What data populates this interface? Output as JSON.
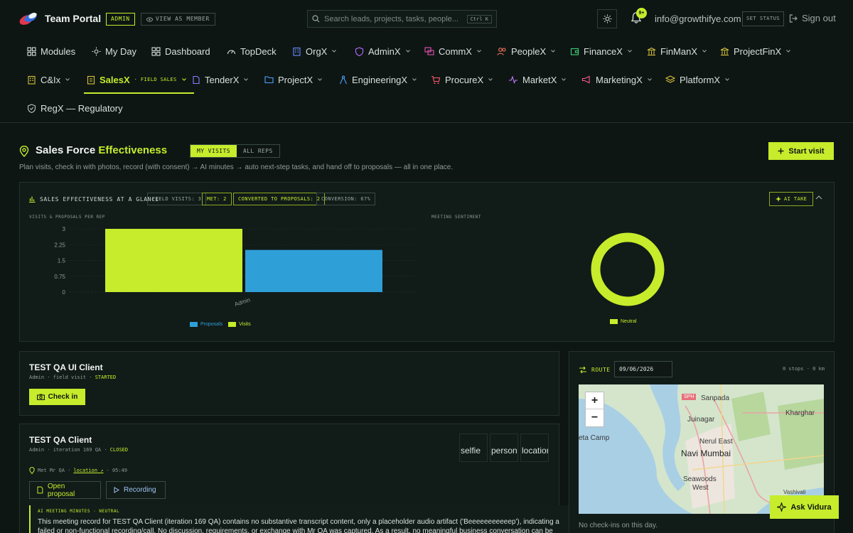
{
  "app": {
    "brand": "Team Portal",
    "role_badge": "ADMIN",
    "view_as": "VIEW AS MEMBER",
    "search_placeholder": "Search leads, projects, tasks, people...",
    "search_shortcut": "Ctrl K",
    "notification_count": "9+",
    "email": "info@growthifye.com",
    "set_status": "SET STATUS",
    "sign_out": "Sign out"
  },
  "nav": {
    "row1": [
      {
        "label": "Modules",
        "icon": "grid-icon"
      },
      {
        "label": "My Day",
        "icon": "sun-icon"
      },
      {
        "label": "Dashboard",
        "icon": "grid-icon"
      },
      {
        "label": "TopDeck",
        "icon": "gauge-icon"
      },
      {
        "label": "OrgX",
        "icon": "building-icon"
      },
      {
        "label": "AdminX",
        "icon": "shield-icon"
      },
      {
        "label": "CommX",
        "icon": "chat-icon"
      },
      {
        "label": "PeopleX",
        "icon": "people-icon"
      },
      {
        "label": "FinanceX",
        "icon": "wallet-icon"
      },
      {
        "label": "FinManX",
        "icon": "bank-icon"
      },
      {
        "label": "ProjectFinX",
        "icon": "bank-icon"
      }
    ],
    "row2": [
      {
        "label": "C&Ix",
        "icon": "building-icon"
      },
      {
        "label": "SalesX",
        "sub": "· FIELD SALES",
        "icon": "clipboard-icon"
      },
      {
        "label": "TenderX",
        "icon": "doc-icon"
      },
      {
        "label": "ProjectX",
        "icon": "folder-icon"
      },
      {
        "label": "EngineeringX",
        "icon": "compass-icon"
      },
      {
        "label": "ProcureX",
        "icon": "cart-icon"
      },
      {
        "label": "MarketX",
        "icon": "pulse-icon"
      },
      {
        "label": "MarketingX",
        "icon": "megaphone-icon"
      },
      {
        "label": "PlatformX",
        "icon": "layers-icon"
      }
    ],
    "row3": [
      {
        "label": "RegX — Regulatory",
        "icon": "shield-icon"
      }
    ]
  },
  "page": {
    "title_a": "Sales Force",
    "title_b": "Effectiveness",
    "tabs": [
      "MY VISITS",
      "ALL REPS"
    ],
    "active_tab": "MY VISITS",
    "start_visit": "Start visit",
    "tagline": "Plan visits, check in with photos, record (with consent) → AI minutes → auto next-step tasks, and hand off to proposals — all in one place."
  },
  "glance": {
    "title": "SALES EFFECTIVENESS AT A GLANCE",
    "chips": [
      "FIELD VISITS: 3",
      "MET: 2",
      "CONVERTED TO PROPOSALS: 2",
      "CONVERSION: 67%"
    ],
    "ai_take": "AI TAKE",
    "bar_label": "VISITS & PROPOSALS PER REP",
    "donut_label": "MEETING SENTIMENT"
  },
  "chart_data": [
    {
      "type": "bar",
      "title": "VISITS & PROPOSALS PER REP",
      "categories": [
        "Admin"
      ],
      "series": [
        {
          "name": "Visits",
          "values": [
            3
          ],
          "color": "#c6ec2b"
        },
        {
          "name": "Proposals",
          "values": [
            2
          ],
          "color": "#2f9fd8"
        }
      ],
      "yticks": [
        "3",
        "2.25",
        "1.5",
        "0.75",
        "0"
      ],
      "ylim": [
        0,
        3
      ],
      "legend_order": [
        "Proposals",
        "Visits"
      ],
      "legend_position": "bottom"
    },
    {
      "type": "pie",
      "title": "MEETING SENTIMENT",
      "categories": [
        "Neutral"
      ],
      "values": [
        1
      ],
      "colors": [
        "#c6ec2b"
      ],
      "legend_position": "bottom"
    }
  ],
  "visits": [
    {
      "client": "TEST QA UI Client",
      "meta": "Admin · field visit · ",
      "status": "STARTED",
      "action": "Check in"
    },
    {
      "client": "TEST QA Client",
      "meta": "Admin · iteration 169 QA · ",
      "status": "CLOSED",
      "thumbs": [
        "selfie",
        "person",
        "location"
      ],
      "met_line": "Met Mr QA ·",
      "location_link": "location ↗",
      "time": "· 05:49",
      "open_proposal": "Open proposal",
      "recording": "Recording",
      "minutes_label": "AI MEETING MINUTES · NEUTRAL",
      "minutes_text": "This meeting record for TEST QA Client (iteration 169 QA) contains no substantive transcript content, only a placeholder audio artifact ('Beeeeeeeeeeep'), indicating a failed or non-functional recording/call. No discussion, requirements, or exchange with Mr QA was captured. As a result, no meaningful business conversation can be"
    }
  ],
  "route": {
    "label": "ROUTE",
    "date": "09/06/2026",
    "stops": "0 stops · 0 km",
    "map_labels": [
      "Sanpada",
      "Kharghar",
      "Juinagar",
      "eta Camp",
      "Nerul East",
      "Navi Mumbai",
      "Seawoods",
      "West",
      "Vashivali",
      "SPH"
    ],
    "zoom_in": "+",
    "zoom_out": "−",
    "empty": "No check-ins on this day."
  },
  "assistant": {
    "label": "Ask Vidura"
  }
}
